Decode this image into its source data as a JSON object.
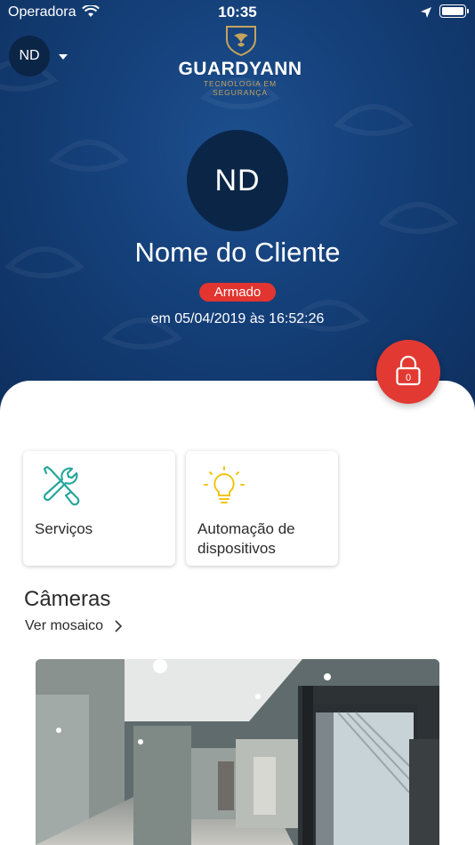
{
  "status_bar": {
    "carrier": "Operadora",
    "time": "10:35"
  },
  "header": {
    "user_initials": "ND",
    "brand_name": "GUARDYANN",
    "brand_tagline": "TECNOLOGIA EM SEGURANÇA"
  },
  "profile": {
    "initials": "ND",
    "client_name": "Nome do Cliente",
    "status": "Armado",
    "status_time": "em 05/04/2019 às 16:52:26",
    "lock_count": "0"
  },
  "cards": [
    {
      "label": "Serviços",
      "icon": "tools-icon"
    },
    {
      "label": "Automação de dispositivos",
      "icon": "lightbulb-icon"
    }
  ],
  "cameras": {
    "title": "Câmeras",
    "link_label": "Ver mosaico"
  },
  "colors": {
    "header_blue": "#143f78",
    "alert_red": "#e2352f",
    "gold": "#c5a35c",
    "tools_teal": "#26a69a",
    "bulb_yellow": "#f2c418"
  }
}
